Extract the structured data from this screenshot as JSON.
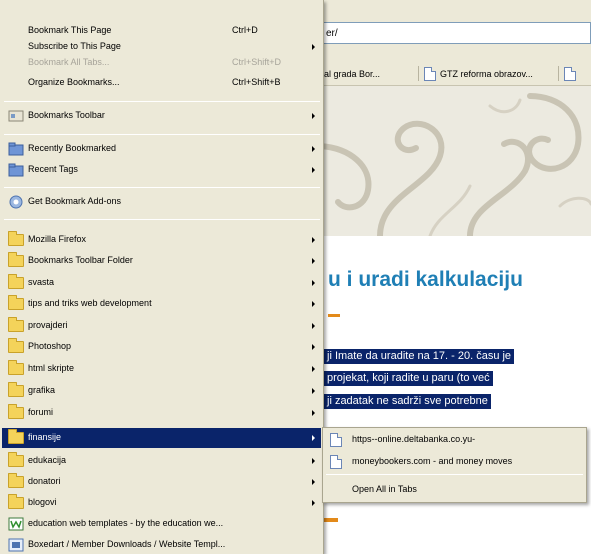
{
  "browser": {
    "address_fragment": "er/",
    "bookmark_tabs": [
      "al grada Bor...",
      "GTZ reforma obrazov...",
      ""
    ],
    "heading": "u i uradi kalkulaciju",
    "highlight_lines": [
      "ji Imate da uradite na 17. - 20. času je",
      "projekat, koji radite u paru (to već",
      "ji zadatak ne sadrži sve potrebne"
    ]
  },
  "menu": {
    "top_items": [
      {
        "label": "Bookmark This Page",
        "shortcut": "Ctrl+D",
        "disabled": false
      },
      {
        "label": "Subscribe to This Page",
        "shortcut": "",
        "disabled": false,
        "submenu": true
      },
      {
        "label": "Bookmark All Tabs...",
        "shortcut": "Ctrl+Shift+D",
        "disabled": true
      },
      {
        "label": "Organize Bookmarks...",
        "shortcut": "Ctrl+Shift+B",
        "disabled": false
      }
    ],
    "toolbar_item": "Bookmarks Toolbar",
    "recent_items": [
      "Recently Bookmarked",
      "Recent Tags"
    ],
    "addons_item": "Get Bookmark Add-ons",
    "folders": [
      "Mozilla Firefox",
      "Bookmarks Toolbar Folder",
      "svasta",
      "tips and triks web development",
      "provajderi",
      "Photoshop",
      "html skripte",
      "grafika",
      "forumi",
      "finansije",
      "edukacija",
      "donatori",
      "blogovi"
    ],
    "selected_folder": "finansije",
    "bookmarks": [
      "education web templates - by the education we...",
      "Boxedart / Member Downloads / Website Templ..."
    ]
  },
  "submenu": {
    "items": [
      "https--online.deltabanka.co.yu-",
      "moneybookers.com - and money moves"
    ],
    "open_all": "Open All in Tabs"
  },
  "colors": {
    "menu_bg": "#ece9d8",
    "selection": "#0a246a",
    "heading": "#1f7fb5",
    "accent": "#e38a1a"
  }
}
